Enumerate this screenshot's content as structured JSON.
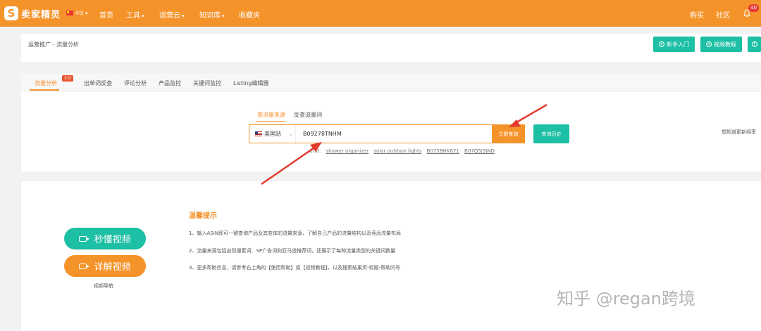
{
  "brand": {
    "logo_glyph": "S",
    "name": "卖家精灵"
  },
  "topbar": {
    "region": "中文",
    "nav": [
      {
        "label": "首页",
        "dropdown": false
      },
      {
        "label": "工具",
        "dropdown": true
      },
      {
        "label": "运营云",
        "dropdown": true
      },
      {
        "label": "知识库",
        "dropdown": true
      },
      {
        "label": "收藏夹",
        "dropdown": false
      }
    ],
    "right": {
      "buy": "购买",
      "community": "社区",
      "notifications": "40"
    }
  },
  "header": {
    "breadcrumb": "运营推广 - 流量分析",
    "buttons": {
      "beginner": "新手入门",
      "video_tutorial": "视频教程",
      "help": "?"
    }
  },
  "tabs": {
    "items": [
      "流量分析",
      "出单词反查",
      "评论分析",
      "产品监控",
      "关键词监控",
      "Listing编辑器"
    ],
    "active_badge": "3.0"
  },
  "search": {
    "types": [
      "查流量来源",
      "反查流量词"
    ],
    "site": "美国站",
    "asin_value": "B09278TNHM",
    "query_button": "立即查询",
    "history_button": "查询历史",
    "examples_label": "示例:",
    "examples": [
      "shower organizer",
      "solar outdoor lights",
      "B075BHK671",
      "B07Q5J3JND"
    ],
    "side_hint": "想知道更新频率"
  },
  "tips": {
    "title": "温馨提示",
    "items": [
      "1、输入ASIN即可一键查询产品及其变体的流量来源，了解自己产品的流量结构以及竞品流量布局",
      "2、流量来源包括自然搜索词、SP广告词和亚马逊推荐词，还展示了每种流量类型的关键词数量",
      "3、更多帮助信息，请参考右上角的【使用帮助】或【视频教程】，以及搜索结果页-标题-帮助问号"
    ]
  },
  "video": {
    "quick": "秒懂视频",
    "detail": "详解视频",
    "nav": "视频导航"
  },
  "watermark": "知乎 @regan跨境",
  "colors": {
    "accent": "#f5932b",
    "teal": "#1dbfa5",
    "arrow": "#e23a2e"
  }
}
